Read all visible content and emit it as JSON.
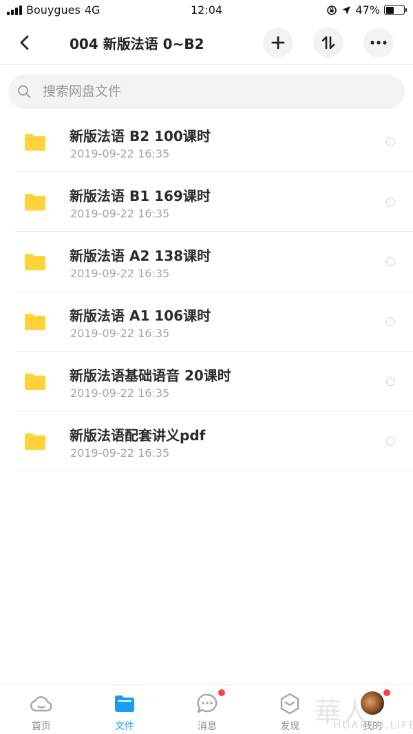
{
  "status_bar": {
    "carrier": "Bouygues",
    "network": "4G",
    "time": "12:04",
    "battery_percent": "47%",
    "battery_level": 0.47
  },
  "nav": {
    "title": "004 新版法语 0~B2",
    "back_icon": "chevron-left-icon",
    "add_icon": "plus-icon",
    "sort_icon": "sort-arrows-icon",
    "more_icon": "more-dots-icon"
  },
  "search": {
    "placeholder": "搜索网盘文件"
  },
  "files": [
    {
      "name": "新版法语 B2  100课时",
      "date": "2019-09-22 16:35"
    },
    {
      "name": "新版法语 B1  169课时",
      "date": "2019-09-22 16:35"
    },
    {
      "name": "新版法语 A2  138课时",
      "date": "2019-09-22 16:35"
    },
    {
      "name": "新版法语 A1  106课时",
      "date": "2019-09-22 16:35"
    },
    {
      "name": "新版法语基础语音 20课时",
      "date": "2019-09-22 16:35"
    },
    {
      "name": "新版法语配套讲义pdf",
      "date": "2019-09-22 16:35"
    }
  ],
  "tabbar": {
    "tabs": [
      {
        "label": "首页",
        "icon": "cloud-icon"
      },
      {
        "label": "文件",
        "icon": "folder-icon",
        "active": true
      },
      {
        "label": "消息",
        "icon": "chat-bubble-icon",
        "badge": true
      },
      {
        "label": "发现",
        "icon": "hexagon-discover-icon"
      },
      {
        "label": "我的",
        "icon": "avatar",
        "badge": true
      }
    ]
  },
  "watermark": {
    "text": "HUAREN.LIFE"
  },
  "colors": {
    "accent": "#1a9cf2",
    "folder": "#ffd43b",
    "badge": "#f4454a",
    "muted_text": "#a3a4a8"
  }
}
